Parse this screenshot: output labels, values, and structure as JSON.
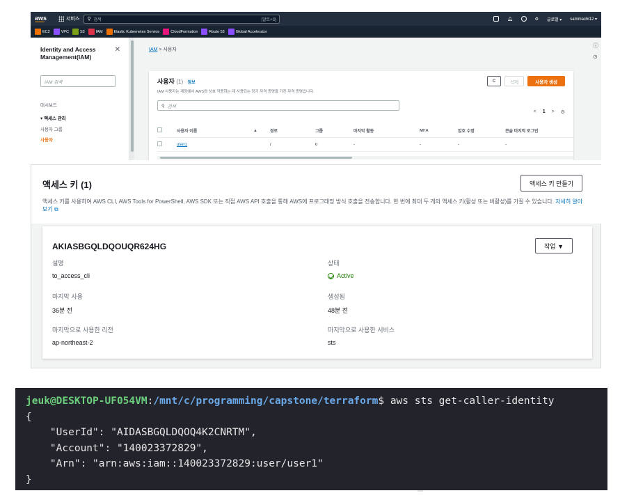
{
  "aws_console": {
    "topnav": {
      "logo": "aws",
      "services": "서비스",
      "search_placeholder": "검색",
      "search_hint": "[알트+S]",
      "region": "글로벌 ▾",
      "account": "sammachi12 ▾"
    },
    "favorites": [
      {
        "label": "EC2",
        "color": "#ed7100"
      },
      {
        "label": "VPC",
        "color": "#8c4fff"
      },
      {
        "label": "S3",
        "color": "#7aa116"
      },
      {
        "label": "IAM",
        "color": "#dd344c"
      },
      {
        "label": "Elastic Kubernetes Service",
        "color": "#ed7100"
      },
      {
        "label": "CloudFormation",
        "color": "#e7157b"
      },
      {
        "label": "Route 53",
        "color": "#8c4fff"
      },
      {
        "label": "Global Accelerator",
        "color": "#8c4fff"
      }
    ],
    "sidebar": {
      "title": "Identity and Access Management(IAM)",
      "search_placeholder": "IAM 검색",
      "dashboard": "대시보드",
      "group": "▾ 액세스 관리",
      "user_groups": "사용자 그룹",
      "users": "사용자"
    },
    "breadcrumb": {
      "root": "IAM",
      "sep": ">",
      "current": "사용자"
    },
    "users_panel": {
      "title": "사용자",
      "count": "(1)",
      "info": "정보",
      "description": "IAM 사용자는 계정에서 AWS와 상호 작용하는 데 사용되는 장기 자격 증명을 가진 자격 증명입니다.",
      "refresh": "C",
      "delete": "삭제",
      "create": "사용자 생성",
      "search_placeholder": "검색",
      "pager": {
        "prev": "<",
        "page": "1",
        "next": ">"
      },
      "columns": [
        "사용자 이름",
        "▲",
        "경로",
        "그룹",
        "마지막 활동",
        "MFA",
        "암호 수명",
        "콘솔 마지막 로그인"
      ],
      "rows": [
        {
          "name": "user1",
          "path": "/",
          "groups": "0",
          "last_activity": "-",
          "mfa": "-",
          "password_age": "-",
          "console_login": "-"
        }
      ]
    }
  },
  "access_keys": {
    "title": "액세스 키 (1)",
    "description": "액세스 키를 사용하여 AWS CLI, AWS Tools for PowerShell, AWS SDK 또는 직접 AWS API 호출을 통해 AWS에 프로그래밍 방식 호출을 전송합니다. 한 번에 최대 두 개의 액세스 키(활성 또는 비활성)를 가질 수 있습니다.",
    "learn_more": "자세히 알아보기",
    "create_button": "액세스 키 만들기",
    "key": {
      "id": "AKIASBGQLDQOUQR624HG",
      "action_button": "작업 ▼",
      "description_label": "설명",
      "description_value": "to_access_cli",
      "status_label": "상태",
      "status_value": "Active",
      "last_used_label": "마지막 사용",
      "last_used_value": "36분 전",
      "created_label": "생성됨",
      "created_value": "48분 전",
      "last_region_label": "마지막으로 사용한 리전",
      "last_region_value": "ap-northeast-2",
      "last_service_label": "마지막으로 사용한 서비스",
      "last_service_value": "sts"
    }
  },
  "terminal": {
    "user": "jeuk@DESKTOP-UF054VM",
    "colon": ":",
    "path": "/mnt/c/programming/capstone/terraform",
    "prompt": "$ ",
    "command": "aws sts get-caller-identity",
    "lines": [
      "{",
      "    \"UserId\": \"AIDASBGQLDQOQ4K2CNRTM\",",
      "    \"Account\": \"140023372829\",",
      "    \"Arn\": \"arn:aws:iam::140023372829:user/user1\"",
      "}"
    ]
  }
}
